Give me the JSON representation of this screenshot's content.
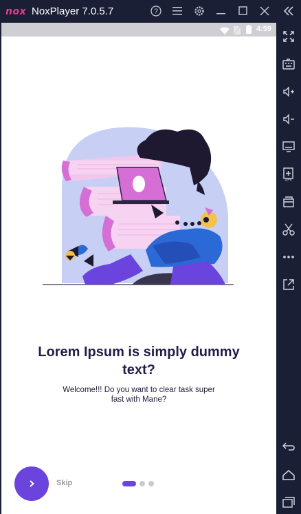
{
  "window": {
    "logo_text": "nox",
    "title": "NoxPlayer 7.0.5.7",
    "titlebar_icons": [
      "help-icon",
      "menu-icon",
      "settings-icon",
      "minimize-icon",
      "maximize-icon",
      "close-icon",
      "collapse-sidebar-icon"
    ]
  },
  "statusbar": {
    "time": "4:59",
    "icons": [
      "wifi-icon",
      "no-sim-icon",
      "battery-icon"
    ]
  },
  "onboarding": {
    "headline": "Lorem Ipsum is simply dummy text?",
    "subtitle": "Welcome!!! Do you want to clear task super fast with Mane?",
    "skip_label": "Skip",
    "next_icon": "chevron-right-icon",
    "page_count": 3,
    "active_page": 1
  },
  "sidebar": {
    "icons": [
      "fullscreen-icon",
      "keyboard-icon",
      "volume-up-icon",
      "volume-down-icon",
      "screen-icon",
      "apk-install-icon",
      "clipboard-icon",
      "scissors-icon",
      "more-icon",
      "export-icon",
      "back-icon",
      "home-icon",
      "recents-icon"
    ]
  },
  "colors": {
    "accent": "#6a44dd",
    "titlebar": "#1b1f35",
    "headline": "#241d46",
    "illustration_bg": "#c7cff5"
  }
}
